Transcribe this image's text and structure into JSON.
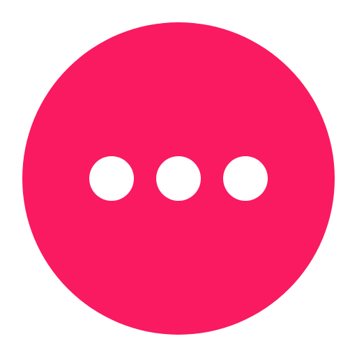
{
  "icon": {
    "name": "more-horizontal-icon",
    "background_color": "#F91A61",
    "dot_color": "#FFFFFF",
    "dot_count": 3
  }
}
